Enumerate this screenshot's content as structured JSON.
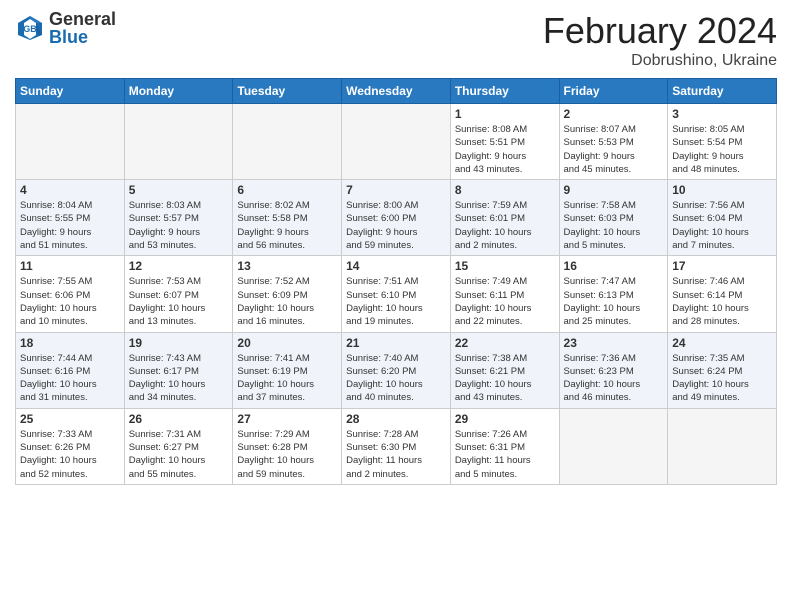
{
  "logo": {
    "general": "General",
    "blue": "Blue"
  },
  "title": "February 2024",
  "location": "Dobrushino, Ukraine",
  "days_of_week": [
    "Sunday",
    "Monday",
    "Tuesday",
    "Wednesday",
    "Thursday",
    "Friday",
    "Saturday"
  ],
  "weeks": [
    {
      "row_class": "row-white",
      "days": [
        {
          "num": "",
          "info": "",
          "empty": true
        },
        {
          "num": "",
          "info": "",
          "empty": true
        },
        {
          "num": "",
          "info": "",
          "empty": true
        },
        {
          "num": "",
          "info": "",
          "empty": true
        },
        {
          "num": "1",
          "info": "Sunrise: 8:08 AM\nSunset: 5:51 PM\nDaylight: 9 hours\nand 43 minutes.",
          "empty": false
        },
        {
          "num": "2",
          "info": "Sunrise: 8:07 AM\nSunset: 5:53 PM\nDaylight: 9 hours\nand 45 minutes.",
          "empty": false
        },
        {
          "num": "3",
          "info": "Sunrise: 8:05 AM\nSunset: 5:54 PM\nDaylight: 9 hours\nand 48 minutes.",
          "empty": false
        }
      ]
    },
    {
      "row_class": "row-alt",
      "days": [
        {
          "num": "4",
          "info": "Sunrise: 8:04 AM\nSunset: 5:55 PM\nDaylight: 9 hours\nand 51 minutes.",
          "empty": false
        },
        {
          "num": "5",
          "info": "Sunrise: 8:03 AM\nSunset: 5:57 PM\nDaylight: 9 hours\nand 53 minutes.",
          "empty": false
        },
        {
          "num": "6",
          "info": "Sunrise: 8:02 AM\nSunset: 5:58 PM\nDaylight: 9 hours\nand 56 minutes.",
          "empty": false
        },
        {
          "num": "7",
          "info": "Sunrise: 8:00 AM\nSunset: 6:00 PM\nDaylight: 9 hours\nand 59 minutes.",
          "empty": false
        },
        {
          "num": "8",
          "info": "Sunrise: 7:59 AM\nSunset: 6:01 PM\nDaylight: 10 hours\nand 2 minutes.",
          "empty": false
        },
        {
          "num": "9",
          "info": "Sunrise: 7:58 AM\nSunset: 6:03 PM\nDaylight: 10 hours\nand 5 minutes.",
          "empty": false
        },
        {
          "num": "10",
          "info": "Sunrise: 7:56 AM\nSunset: 6:04 PM\nDaylight: 10 hours\nand 7 minutes.",
          "empty": false
        }
      ]
    },
    {
      "row_class": "row-white",
      "days": [
        {
          "num": "11",
          "info": "Sunrise: 7:55 AM\nSunset: 6:06 PM\nDaylight: 10 hours\nand 10 minutes.",
          "empty": false
        },
        {
          "num": "12",
          "info": "Sunrise: 7:53 AM\nSunset: 6:07 PM\nDaylight: 10 hours\nand 13 minutes.",
          "empty": false
        },
        {
          "num": "13",
          "info": "Sunrise: 7:52 AM\nSunset: 6:09 PM\nDaylight: 10 hours\nand 16 minutes.",
          "empty": false
        },
        {
          "num": "14",
          "info": "Sunrise: 7:51 AM\nSunset: 6:10 PM\nDaylight: 10 hours\nand 19 minutes.",
          "empty": false
        },
        {
          "num": "15",
          "info": "Sunrise: 7:49 AM\nSunset: 6:11 PM\nDaylight: 10 hours\nand 22 minutes.",
          "empty": false
        },
        {
          "num": "16",
          "info": "Sunrise: 7:47 AM\nSunset: 6:13 PM\nDaylight: 10 hours\nand 25 minutes.",
          "empty": false
        },
        {
          "num": "17",
          "info": "Sunrise: 7:46 AM\nSunset: 6:14 PM\nDaylight: 10 hours\nand 28 minutes.",
          "empty": false
        }
      ]
    },
    {
      "row_class": "row-alt",
      "days": [
        {
          "num": "18",
          "info": "Sunrise: 7:44 AM\nSunset: 6:16 PM\nDaylight: 10 hours\nand 31 minutes.",
          "empty": false
        },
        {
          "num": "19",
          "info": "Sunrise: 7:43 AM\nSunset: 6:17 PM\nDaylight: 10 hours\nand 34 minutes.",
          "empty": false
        },
        {
          "num": "20",
          "info": "Sunrise: 7:41 AM\nSunset: 6:19 PM\nDaylight: 10 hours\nand 37 minutes.",
          "empty": false
        },
        {
          "num": "21",
          "info": "Sunrise: 7:40 AM\nSunset: 6:20 PM\nDaylight: 10 hours\nand 40 minutes.",
          "empty": false
        },
        {
          "num": "22",
          "info": "Sunrise: 7:38 AM\nSunset: 6:21 PM\nDaylight: 10 hours\nand 43 minutes.",
          "empty": false
        },
        {
          "num": "23",
          "info": "Sunrise: 7:36 AM\nSunset: 6:23 PM\nDaylight: 10 hours\nand 46 minutes.",
          "empty": false
        },
        {
          "num": "24",
          "info": "Sunrise: 7:35 AM\nSunset: 6:24 PM\nDaylight: 10 hours\nand 49 minutes.",
          "empty": false
        }
      ]
    },
    {
      "row_class": "row-white",
      "days": [
        {
          "num": "25",
          "info": "Sunrise: 7:33 AM\nSunset: 6:26 PM\nDaylight: 10 hours\nand 52 minutes.",
          "empty": false
        },
        {
          "num": "26",
          "info": "Sunrise: 7:31 AM\nSunset: 6:27 PM\nDaylight: 10 hours\nand 55 minutes.",
          "empty": false
        },
        {
          "num": "27",
          "info": "Sunrise: 7:29 AM\nSunset: 6:28 PM\nDaylight: 10 hours\nand 59 minutes.",
          "empty": false
        },
        {
          "num": "28",
          "info": "Sunrise: 7:28 AM\nSunset: 6:30 PM\nDaylight: 11 hours\nand 2 minutes.",
          "empty": false
        },
        {
          "num": "29",
          "info": "Sunrise: 7:26 AM\nSunset: 6:31 PM\nDaylight: 11 hours\nand 5 minutes.",
          "empty": false
        },
        {
          "num": "",
          "info": "",
          "empty": true
        },
        {
          "num": "",
          "info": "",
          "empty": true
        }
      ]
    }
  ]
}
